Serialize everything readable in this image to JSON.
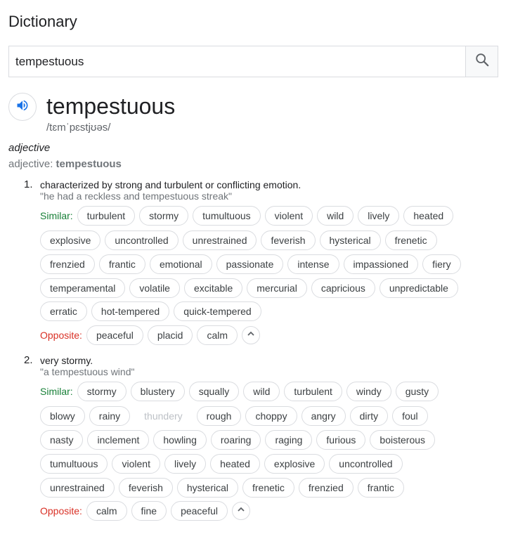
{
  "header": {
    "title": "Dictionary"
  },
  "search": {
    "value": "tempestuous"
  },
  "entry": {
    "word": "tempestuous",
    "phonetic": "/tɛmˈpɛstjʊəs/",
    "pos": "adjective",
    "pos_line_prefix": "adjective:",
    "pos_line_word": "tempestuous"
  },
  "senses": [
    {
      "number": "1.",
      "definition": "characterized by strong and turbulent or conflicting emotion.",
      "example": "\"he had a reckless and tempestuous streak\"",
      "similar_label": "Similar:",
      "similar_rows": [
        [
          "turbulent",
          "stormy",
          "tumultuous",
          "violent",
          "wild",
          "lively",
          "heated"
        ],
        [
          "explosive",
          "uncontrolled",
          "unrestrained",
          "feverish",
          "hysterical",
          "frenetic"
        ],
        [
          "frenzied",
          "frantic",
          "emotional",
          "passionate",
          "intense",
          "impassioned",
          "fiery"
        ],
        [
          "temperamental",
          "volatile",
          "excitable",
          "mercurial",
          "capricious",
          "unpredictable"
        ],
        [
          "erratic",
          "hot-tempered",
          "quick-tempered"
        ]
      ],
      "opposite_label": "Opposite:",
      "opposites": [
        "peaceful",
        "placid",
        "calm"
      ]
    },
    {
      "number": "2.",
      "definition": "very stormy.",
      "example": "\"a tempestuous wind\"",
      "similar_label": "Similar:",
      "similar_rows": [
        [
          "stormy",
          "blustery",
          "squally",
          "wild",
          "turbulent",
          "windy",
          "gusty"
        ],
        [
          "blowy",
          "rainy",
          "thundery",
          "rough",
          "choppy",
          "angry",
          "dirty",
          "foul"
        ],
        [
          "nasty",
          "inclement",
          "howling",
          "roaring",
          "raging",
          "furious",
          "boisterous"
        ],
        [
          "tumultuous",
          "violent",
          "lively",
          "heated",
          "explosive",
          "uncontrolled"
        ],
        [
          "unrestrained",
          "feverish",
          "hysterical",
          "frenetic",
          "frenzied",
          "frantic"
        ]
      ],
      "faded_words": [
        "thundery"
      ],
      "opposite_label": "Opposite:",
      "opposites": [
        "calm",
        "fine",
        "peaceful"
      ]
    }
  ],
  "icons": {
    "search": "search-icon",
    "audio": "speaker-icon",
    "collapse": "chevron-up-icon"
  },
  "colors": {
    "similar_label": "#188038",
    "opposite_label": "#d93025",
    "audio_icon": "#1a73e8"
  }
}
